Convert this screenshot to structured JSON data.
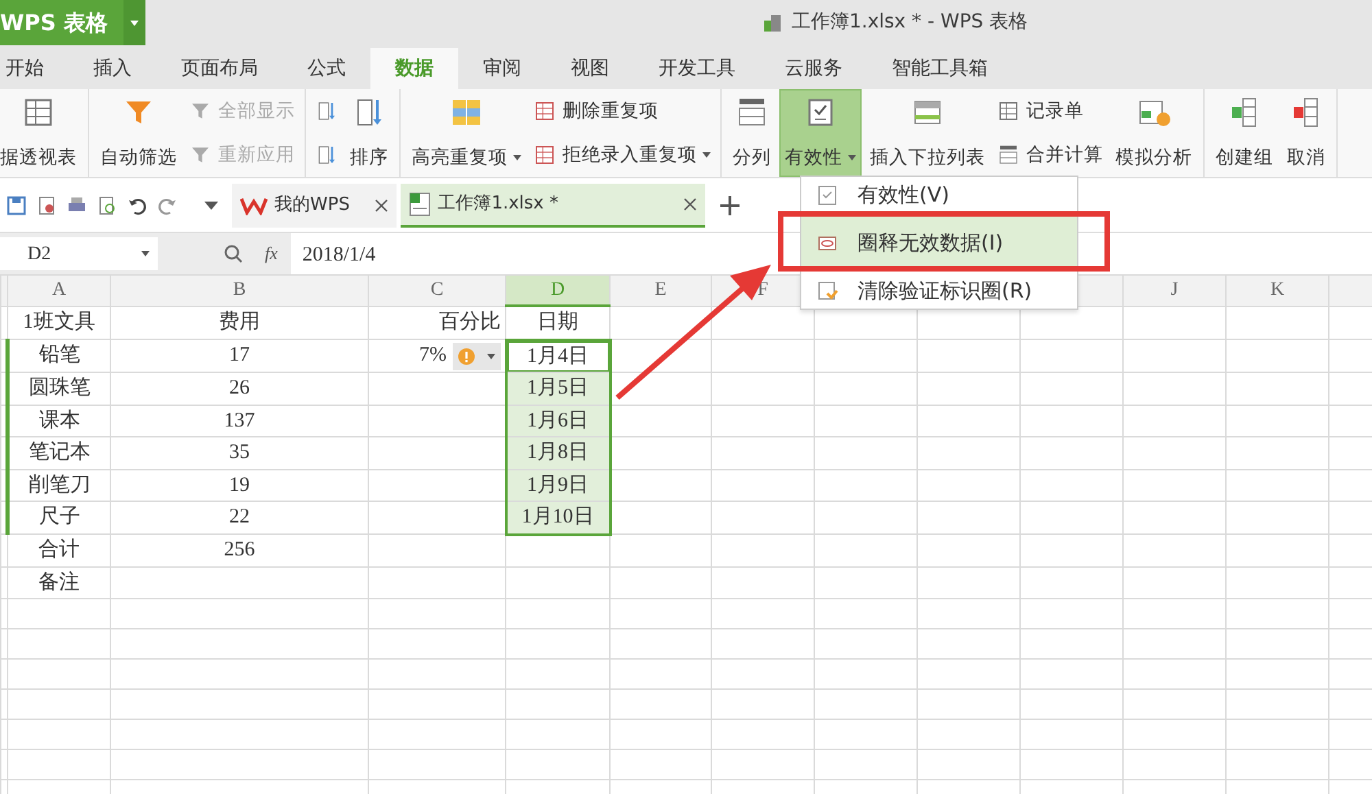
{
  "app_button": {
    "label": "WPS 表格"
  },
  "window": {
    "title": "工作簿1.xlsx * - WPS 表格"
  },
  "ribbon_tabs": [
    {
      "label": "开始",
      "selected": false
    },
    {
      "label": "插入",
      "selected": false
    },
    {
      "label": "页面布局",
      "selected": false
    },
    {
      "label": "公式",
      "selected": false
    },
    {
      "label": "数据",
      "selected": true
    },
    {
      "label": "审阅",
      "selected": false
    },
    {
      "label": "视图",
      "selected": false
    },
    {
      "label": "开发工具",
      "selected": false
    },
    {
      "label": "云服务",
      "selected": false
    },
    {
      "label": "智能工具箱",
      "selected": false
    }
  ],
  "ribbon_groups": [
    {
      "items": [
        {
          "kind": "large",
          "label": "据透视表",
          "dropdown": false,
          "active": false
        }
      ]
    },
    {
      "items": [
        {
          "kind": "large",
          "label": "自动筛选",
          "dropdown": false,
          "active": false
        },
        {
          "kind": "stack",
          "items": [
            {
              "label": "全部显示",
              "disabled": true,
              "dropdown": false
            },
            {
              "label": "重新应用",
              "disabled": true,
              "dropdown": false
            }
          ]
        }
      ]
    },
    {
      "items": [
        {
          "kind": "sort_icons"
        },
        {
          "kind": "large",
          "label": "排序",
          "dropdown": false,
          "active": false
        }
      ]
    },
    {
      "items": [
        {
          "kind": "large",
          "label": "高亮重复项",
          "dropdown": true,
          "active": false
        },
        {
          "kind": "stack",
          "items": [
            {
              "label": "删除重复项",
              "disabled": false,
              "dropdown": false
            },
            {
              "label": "拒绝录入重复项",
              "disabled": false,
              "dropdown": true
            }
          ]
        }
      ]
    },
    {
      "items": [
        {
          "kind": "large",
          "label": "分列",
          "dropdown": false,
          "active": false
        },
        {
          "kind": "large",
          "label": "有效性",
          "dropdown": true,
          "active": true
        },
        {
          "kind": "large",
          "label": "插入下拉列表",
          "dropdown": false,
          "active": false
        },
        {
          "kind": "stack",
          "items": [
            {
              "label": "记录单",
              "disabled": false,
              "dropdown": false
            },
            {
              "label": "合并计算",
              "disabled": false,
              "dropdown": false
            }
          ]
        },
        {
          "kind": "large",
          "label": "模拟分析",
          "dropdown": false,
          "active": false
        }
      ]
    },
    {
      "items": [
        {
          "kind": "large",
          "label": "创建组",
          "dropdown": false,
          "active": false
        },
        {
          "kind": "large",
          "label": "取消",
          "dropdown": false,
          "active": false
        }
      ]
    }
  ],
  "doc_tabs": [
    {
      "label": "我的WPS",
      "selected": false
    },
    {
      "label": "工作簿1.xlsx *",
      "selected": true
    }
  ],
  "formula_bar": {
    "name_box": "D2",
    "function_label": "fx",
    "value": "2018/1/4"
  },
  "columns": [
    {
      "label": "A",
      "selected": false
    },
    {
      "label": "B",
      "selected": false
    },
    {
      "label": "C",
      "selected": false
    },
    {
      "label": "D",
      "selected": true
    },
    {
      "label": "E",
      "selected": false
    },
    {
      "label": "F",
      "selected": false
    }
  ],
  "columns_right": [
    {
      "label": "J",
      "selected": false
    },
    {
      "label": "K",
      "selected": false
    }
  ],
  "rows": [
    {
      "cells": [
        "1班文具",
        "费用",
        "百分比",
        "日期"
      ],
      "selected": false,
      "active": false,
      "smart_tag": false
    },
    {
      "cells": [
        "铅笔",
        "17",
        "7%",
        "1月4日"
      ],
      "selected": true,
      "active": true,
      "smart_tag": true
    },
    {
      "cells": [
        "圆珠笔",
        "26",
        "",
        "1月5日"
      ],
      "selected": true,
      "active": false,
      "smart_tag": false
    },
    {
      "cells": [
        "课本",
        "137",
        "",
        "1月6日"
      ],
      "selected": true,
      "active": false,
      "smart_tag": false
    },
    {
      "cells": [
        "笔记本",
        "35",
        "",
        "1月8日"
      ],
      "selected": true,
      "active": false,
      "smart_tag": false
    },
    {
      "cells": [
        "削笔刀",
        "19",
        "",
        "1月9日"
      ],
      "selected": true,
      "active": false,
      "smart_tag": false
    },
    {
      "cells": [
        "尺子",
        "22",
        "",
        "1月10日"
      ],
      "selected": true,
      "active": false,
      "smart_tag": false
    },
    {
      "cells": [
        "合计",
        "256"
      ],
      "selected": false,
      "active": false,
      "smart_tag": false
    },
    {
      "cells": [
        "备注"
      ],
      "selected": false,
      "active": false,
      "smart_tag": false
    }
  ],
  "validity_menu": [
    {
      "label": "有效性(V)",
      "selected": false
    },
    {
      "label": "圈释无效数据(I)",
      "selected": true
    },
    {
      "label": "清除验证标识圈(R)",
      "selected": false
    }
  ]
}
